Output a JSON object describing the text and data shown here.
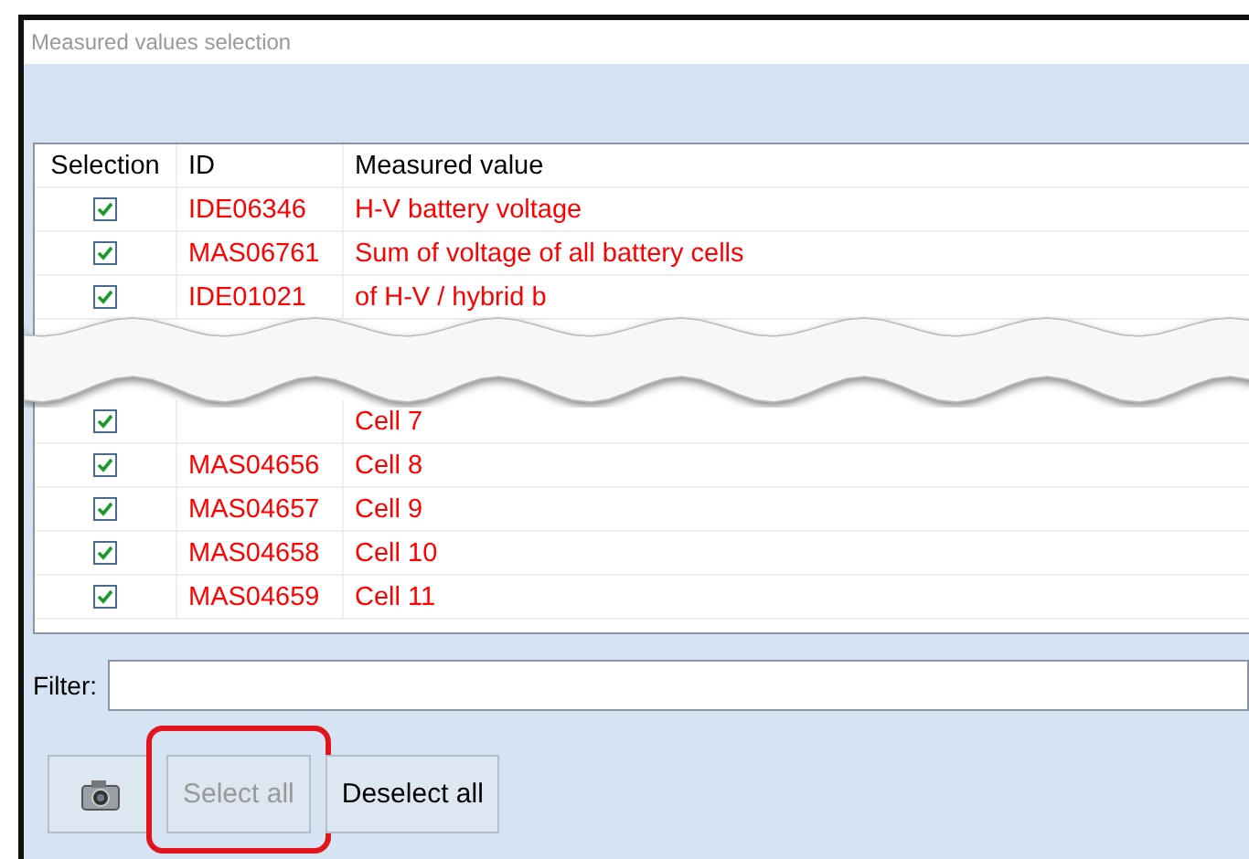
{
  "window": {
    "title": "Measured values selection"
  },
  "table": {
    "columns": [
      "Selection",
      "ID",
      "Measured value"
    ],
    "rows": [
      {
        "checked": true,
        "id": "IDE06346",
        "value": "H-V battery voltage"
      },
      {
        "checked": true,
        "id": "MAS06761",
        "value": "Sum of voltage of all battery cells"
      },
      {
        "checked": true,
        "id": "IDE01021",
        "value": "of H-V / hybrid b"
      }
    ],
    "rows_after_gap": [
      {
        "checked": true,
        "value": "Cell 7"
      },
      {
        "checked": true,
        "id": "MAS04656",
        "value": "Cell 8"
      },
      {
        "checked": true,
        "id": "MAS04657",
        "value": "Cell 9"
      },
      {
        "checked": true,
        "id": "MAS04658",
        "value": "Cell 10"
      },
      {
        "checked": true,
        "id": "MAS04659",
        "value": "Cell 11"
      }
    ]
  },
  "filter": {
    "label": "Filter:"
  },
  "buttons": [
    {
      "kind": "icon"
    },
    {
      "kind": "text",
      "label": "Select all",
      "disabled": true,
      "highlighted": true
    },
    {
      "kind": "text",
      "label": "Deselect all",
      "disabled": false,
      "highlighted": false
    }
  ]
}
